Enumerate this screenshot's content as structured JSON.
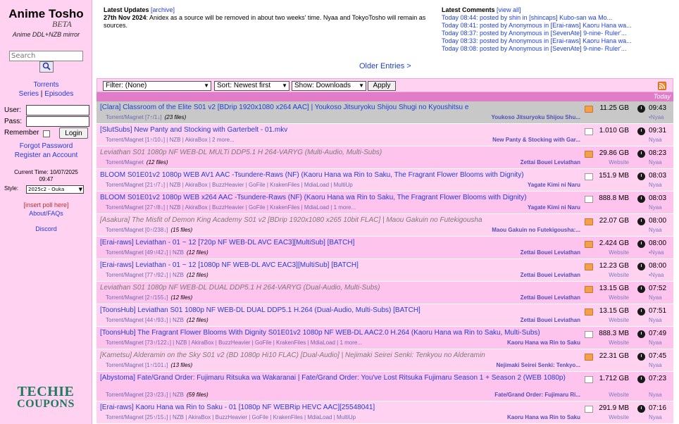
{
  "sidebar": {
    "logo_title": "Anime Tosho",
    "logo_beta": "BETA",
    "logo_sub": "Anime DDL+NZB mirror",
    "search_placeholder": "Search",
    "nav_torrents": "Torrents",
    "nav_series": "Series",
    "nav_sep": "|",
    "nav_episodes": "Episodes",
    "user_label": "User:",
    "pass_label": "Pass:",
    "remember_label": "Remember",
    "login_button": "Login",
    "forgot_password": "Forgot Password",
    "register": "Register an Account",
    "current_time_label": "Current Time: 10/07/2025",
    "current_time": "09:47",
    "style_label": "Style:",
    "style_value": "2025c2 - Ouka",
    "insert_poll": "[insert poll here]",
    "about": "About/FAQs",
    "discord": "Discord",
    "ad_line1": "TECHIE",
    "ad_line2": "COUPONS"
  },
  "updates": {
    "title": "Latest Updates",
    "archive": "[archive]",
    "date": "27th Nov 2024",
    "text": ": Anidex as a source will be removed in about two weeks' time. Nyaa and TokyoTosho will remain as sources."
  },
  "comments": {
    "title": "Latest Comments",
    "view_all": "[view all]",
    "items": [
      "Today 08:44: posted by shin in [shincaps] Kubo-san wa Mo...",
      "Today 08:41: posted by Anonymous in [Erai-raws] Kaoru Hana wa...",
      "Today 08:37: posted by Anonymous in [SevenAte] 9-nine- Ruler'...",
      "Today 08:33: posted by Anonymous in [Erai-raws] Kaoru Hana wa...",
      "Today 08:08: posted by Anonymous in [SevenAte] 9-nine- Ruler'..."
    ]
  },
  "older_entries": "Older Entries >",
  "filter": {
    "filter_value": "Filter: (None)",
    "sort_value": "Sort: Newest first",
    "show_value": "Show: Downloads",
    "apply": "Apply",
    "day_label": "Today"
  },
  "rows": [
    {
      "title": "[Clara] Classroom of the Elite S01 v2 [BDrip 1920x1080 x264 AAC] | Youkoso Jitsuryoku Shijou Shugi no Kyoushitsu e",
      "links": "Torrent/Magnet [7↑/1↓]",
      "count": "(23 files)",
      "series": "Youkoso Jitsuryoku Shijou Shu...",
      "size": "11.25 GB",
      "time": "09:43",
      "uploader": "•Nyaa"
    },
    {
      "title": "[SlutSubs] New Panty and Stocking with Garterbelt - 01.mkv",
      "links": "Torrent/Magnet [1↑/10↓] | NZB | AkiraBox | 2 more...",
      "count": "",
      "series": "New Panty & Stocking with Gar...",
      "size": "1.010 GB",
      "time": "09:31",
      "uploader": "Nyaa"
    },
    {
      "title": "Leviathan S01 1080p NF WEB-DL MULTi DDP5.1 H 264-VARYG (Multi-Audio, Multi-Subs)",
      "links": "Torrent/Magnet",
      "count": "(12 files)",
      "series": "Zettai Bouei Leviathan",
      "size": "29.86 GB",
      "time": "08:23",
      "website": "Website",
      "uploader": "Nyaa"
    },
    {
      "title": "BLOOM S01E01v2 1080p WEB AV1 AAC -Tsundere-Raws (NF) (Kaoru Hana wa Rin to Saku, The Fragrant Flower Blooms with Dignity)",
      "links": "Torrent/Magnet [21↑/7↓] | NZB | AkiraBox | BuzzHeavier | GoFile | KrakenFiles | MdiaLoad | MultiUp",
      "count": "",
      "series": "Yagate Kimi ni Naru",
      "size": "151.9 MB",
      "time": "08:03",
      "uploader": "Nyaa"
    },
    {
      "title": "BLOOM S01E01v2 1080p WEB x264 AAC -Tsundere-Raws (NF) (Kaoru Hana wa Rin to Saku, The Fragrant Flower Blooms with Dignity)",
      "links": "Torrent/Magnet [27↑/8↓] | NZB | AkiraBox | BuzzHeavier | GoFile | KrakenFiles | MdiaLoad | 1 more...",
      "count": "",
      "series": "Yagate Kimi ni Naru",
      "size": "888.8 MB",
      "time": "08:03",
      "uploader": "Nyaa"
    },
    {
      "title": "[Asakura] The Misfit of Demon King Academy S01 v2 [BDrip 1920x1080 x265 10bit FLAC] | Maou Gakuin no Futekigousha",
      "links": "Torrent/Magnet [0↑/238↓]",
      "count": "(15 files)",
      "series": "Maou Gakuin no Futekigousha:...",
      "size": "22.07 GB",
      "time": "08:00",
      "uploader": "Nyaa"
    },
    {
      "title": "[Erai-raws] Leviathan - 01 ~ 12 [720p NF WEB-DL AVC EAC3][MultiSub] [BATCH]",
      "links": "Torrent/Magnet [49↑/42↓] | NZB",
      "count": "(12 files)",
      "series": "Zettai Bouei Leviathan",
      "size": "2.424 GB",
      "time": "08:00",
      "website": "Website",
      "uploader": "•Nyaa"
    },
    {
      "title": "[Erai-raws] Leviathan - 01 ~ 12 [1080p NF WEB-DL AVC EAC3][MultiSub] [BATCH]",
      "links": "Torrent/Magnet [77↑/92↓] | NZB",
      "count": "(12 files)",
      "series": "Zettai Bouei Leviathan",
      "size": "12.23 GB",
      "time": "08:00",
      "website": "Website",
      "uploader": "•Nyaa"
    },
    {
      "title": "Leviathan S01 1080p NF WEB-DL DUAL DDP5.1 H 264-VARYG (Dual-Audio, Multi-Subs)",
      "links": "Torrent/Magnet [2↑/155↓]",
      "count": "(12 files)",
      "series": "Zettai Bouei Leviathan",
      "size": "13.15 GB",
      "time": "07:52",
      "website": "Website",
      "uploader": "Nyaa"
    },
    {
      "title": "[ToonsHub] Leviathan S01 1080p NF WEB-DL DUAL DDP5.1 H.264 (Dual-Audio, Multi-Subs) [BATCH]",
      "links": "Torrent/Magnet [44↑/93↓] | NZB",
      "count": "(12 files)",
      "series": "Zettai Bouei Leviathan",
      "size": "13.15 GB",
      "time": "07:51",
      "website": "Website",
      "uploader": "Nyaa"
    },
    {
      "title": "[ToonsHub] The Fragrant Flower Blooms With Dignity S01E01v2 1080p NF WEB-DL AAC2.0 H.264 (Kaoru Hana wa Rin to Saku, Multi-Subs)",
      "links": "Torrent/Magnet [73↑/122↓] | NZB | AkiraBox | BuzzHeavier | GoFile | KrakenFiles | MdiaLoad | 1 more...",
      "count": "",
      "series": "Kaoru Hana wa Rin to Saku",
      "size": "888.3 MB",
      "time": "07:49",
      "website": "Website",
      "uploader": "Nyaa"
    },
    {
      "title": "[Kametsu] Alderamin on the Sky S01 v2 (BD 1080p Hi10 FLAC) [Dual-Audio] | Nejimaki Seirei Senki: Tenkyou no Alderamin",
      "links": "Torrent/Magnet [1↑/101↓]",
      "count": "(13 files)",
      "series": "Nejimaki Seirei Senki: Tenkyo...",
      "size": "22.31 GB",
      "time": "07:45",
      "uploader": "Nyaa"
    },
    {
      "title": "[Abystoma] Fate/Grand Order: Fujimaru Ritsuka wa Wakaranai | Fate/Grand Order: You've Lost Ritsuka Fujimaru Season 1 + Season 2 (WEB 1080p)",
      "links": "Torrent/Magnet [23↑/23↓] | NZB",
      "count": "(59 files)",
      "series": "Fate/Grand Order: Fujimaru Ri...",
      "size": "1.712 GB",
      "time": "07:23",
      "website": "Website",
      "uploader": "Nyaa"
    },
    {
      "title": "[Erai-raws] Kaoru Hana wa Rin to Saku - 01 [1080p NF WEBRip HEVC AAC][25548041]",
      "links": "Torrent/Magnet [25↑/15↓] | NZB | AkiraBox | BuzzHeavier | GoFile | KrakenFiles | MdiaLoad | MultiUp",
      "count": "",
      "series": "Kaoru Hana wa Rin to Saku",
      "size": "291.9 MB",
      "time": "07:16",
      "website": "Website",
      "uploader": "Nyaa"
    }
  ],
  "colors": {
    "sidebar_bg": "#ffd2f2",
    "row_bg": "#ffd2f2",
    "row_alt_bg": "#ffc4ee",
    "selected_row_bg": "#c8c8c8",
    "day_bar": "#e07cc8",
    "link": "#1f3fd6"
  }
}
